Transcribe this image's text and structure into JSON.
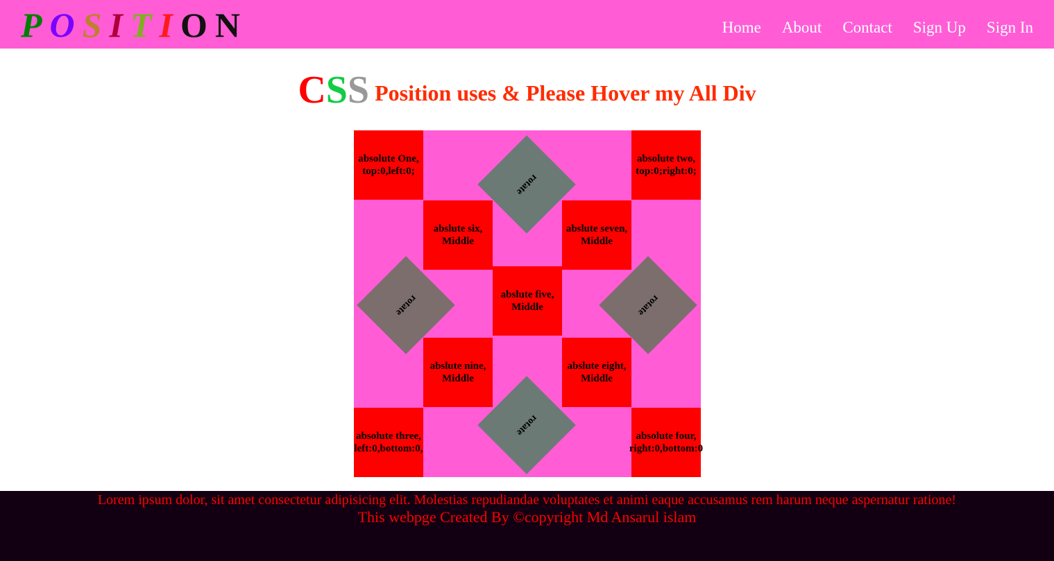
{
  "logo": {
    "letters": [
      {
        "char": "P",
        "color": "#008000"
      },
      {
        "char": "O",
        "color": "#7a00ff"
      },
      {
        "char": "S",
        "color": "#c08030"
      },
      {
        "char": "I",
        "color": "#b0003a"
      },
      {
        "char": "T",
        "color": "#80b020"
      },
      {
        "char": "I",
        "color": "#ff1a1a"
      },
      {
        "char": "O",
        "color": "#111111"
      },
      {
        "char": "N",
        "color": "#111111"
      }
    ]
  },
  "nav": {
    "items": [
      "Home",
      "About",
      "Contact",
      "Sign Up",
      "Sign In"
    ]
  },
  "heading": {
    "c": "C",
    "s1": "S",
    "s2": "S",
    "rest": "Position uses & Please Hover my All Div",
    "colors": {
      "c": "#ff0000",
      "s1": "#11cc44",
      "s2": "#999999"
    }
  },
  "boxes": {
    "one": {
      "line1": "absolute One,",
      "line2": "top:0,left:0;"
    },
    "two": {
      "line1": "absolute two,",
      "line2": "top:0;right:0;"
    },
    "three": {
      "line1": "absolute three,",
      "line2": "left:0,bottom:0,"
    },
    "four": {
      "line1": "absolute four,",
      "line2": "right:0,bottom:0"
    },
    "five": {
      "line1": "abslute five,",
      "line2": "Middle"
    },
    "six": {
      "line1": "abslute six,",
      "line2": "Middle"
    },
    "seven": {
      "line1": "abslute seven,",
      "line2": "Middle"
    },
    "eight": {
      "line1": "abslute eight,",
      "line2": "Middle"
    },
    "nine": {
      "line1": "abslute nine,",
      "line2": "Middle"
    }
  },
  "diamonds": {
    "label": "rotate",
    "top_color": "#6b7a75",
    "side_color": "#7d6e6e"
  },
  "colors": {
    "navbar": "#ff5cd6",
    "stage": "#ff5cd6",
    "box": "#ff0000",
    "footer_bg": "#120012",
    "footer_text": "#ff0000"
  },
  "footer": {
    "line1": "Lorem ipsum dolor, sit amet consectetur adipisicing elit. Molestias repudiandae voluptates et animi eaque accusamus rem harum neque aspernatur ratione!",
    "line2": "This webpge Created By ©copyright Md Ansarul islam"
  }
}
